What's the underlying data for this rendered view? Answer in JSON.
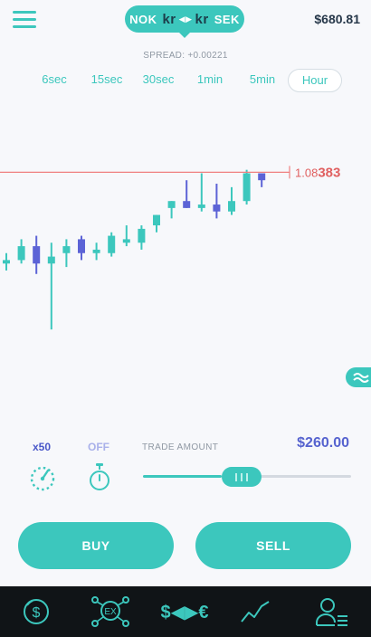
{
  "header": {
    "base": "NOK",
    "base_symbol": "kr",
    "swap_glyph": "◀▶",
    "quote_symbol": "kr",
    "quote": "SEK",
    "balance": "$680.81",
    "spread": "SPREAD: +0.00221",
    "menu_icon": "hamburger-icon"
  },
  "timeframes": [
    {
      "label": "6sec",
      "active": false
    },
    {
      "label": "15sec",
      "active": false
    },
    {
      "label": "30sec",
      "active": false
    },
    {
      "label": "1min",
      "active": false
    },
    {
      "label": "5min",
      "active": false
    },
    {
      "label": "Hour",
      "active": true
    }
  ],
  "chart_data": {
    "type": "candlestick",
    "current_price_prefix": "1.08",
    "current_price_suffix": "383",
    "current_price": 1.08383,
    "colors": {
      "up": "#3cc7bd",
      "down": "#5c63d6",
      "price_line": "#f08080",
      "price_text": "#e06060"
    },
    "candles": [
      {
        "o": 1.0812,
        "h": 1.0815,
        "l": 1.081,
        "c": 1.0813
      },
      {
        "o": 1.0813,
        "h": 1.0819,
        "l": 1.0812,
        "c": 1.0817
      },
      {
        "o": 1.0817,
        "h": 1.082,
        "l": 1.0809,
        "c": 1.0812
      },
      {
        "o": 1.0812,
        "h": 1.0818,
        "l": 1.0793,
        "c": 1.0814
      },
      {
        "o": 1.0815,
        "h": 1.0819,
        "l": 1.0811,
        "c": 1.0817
      },
      {
        "o": 1.0819,
        "h": 1.082,
        "l": 1.0813,
        "c": 1.0815
      },
      {
        "o": 1.0815,
        "h": 1.0818,
        "l": 1.0813,
        "c": 1.0816
      },
      {
        "o": 1.0815,
        "h": 1.0821,
        "l": 1.0814,
        "c": 1.082
      },
      {
        "o": 1.0818,
        "h": 1.0823,
        "l": 1.0817,
        "c": 1.0819
      },
      {
        "o": 1.0818,
        "h": 1.0823,
        "l": 1.0816,
        "c": 1.0822
      },
      {
        "o": 1.0823,
        "h": 1.0826,
        "l": 1.0821,
        "c": 1.0826
      },
      {
        "o": 1.0828,
        "h": 1.083,
        "l": 1.0825,
        "c": 1.083
      },
      {
        "o": 1.083,
        "h": 1.0836,
        "l": 1.0828,
        "c": 1.0828
      },
      {
        "o": 1.0828,
        "h": 1.0838,
        "l": 1.0827,
        "c": 1.0829
      },
      {
        "o": 1.0829,
        "h": 1.0835,
        "l": 1.0825,
        "c": 1.0827
      },
      {
        "o": 1.0827,
        "h": 1.0834,
        "l": 1.0826,
        "c": 1.083
      },
      {
        "o": 1.083,
        "h": 1.0839,
        "l": 1.0829,
        "c": 1.0838
      },
      {
        "o": 1.0838,
        "h": 1.0838,
        "l": 1.0834,
        "c": 1.0836
      }
    ]
  },
  "side_handle_icon": "waves-icon",
  "controls": {
    "multiplier": "x50",
    "timer_state": "OFF",
    "trade_amount_label": "TRADE AMOUNT",
    "trade_amount": "$260.00",
    "slider_fraction": 0.38,
    "gauge_icon": "gauge-icon",
    "timer_icon": "stopwatch-icon"
  },
  "actions": {
    "buy": "BUY",
    "sell": "SELL"
  },
  "nav": {
    "items": [
      "dollar-coin-icon",
      "exchange-network-icon",
      "currency-exchange-icon",
      "trend-chart-icon",
      "profile-list-icon"
    ],
    "exchange_text": "$◀▶€",
    "exchange_badge": "EX",
    "dollar": "$",
    "accent": "#3cc7bd"
  }
}
